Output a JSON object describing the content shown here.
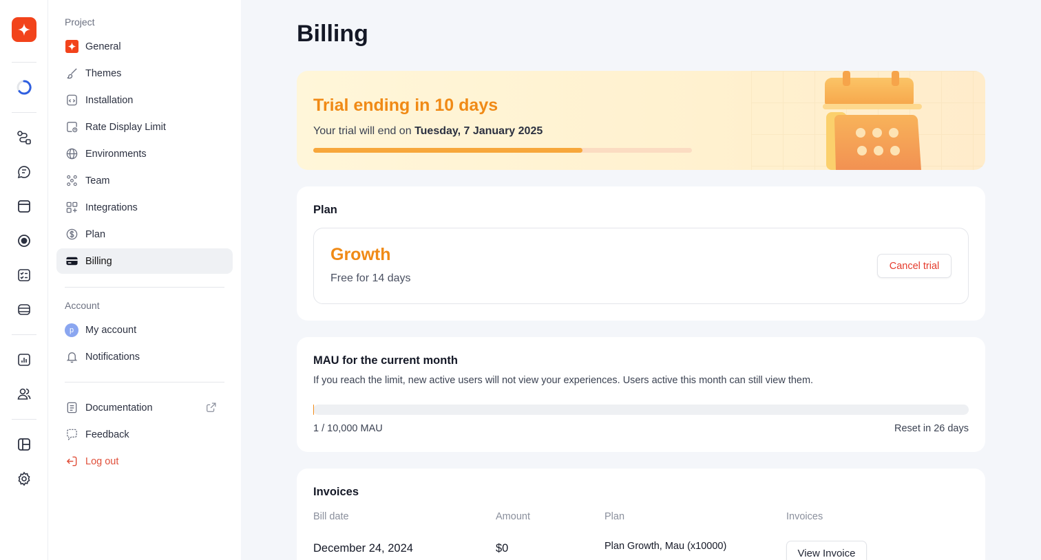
{
  "sidebar": {
    "project_label": "Project",
    "project_items": [
      {
        "label": "General",
        "icon": "brand-icon"
      },
      {
        "label": "Themes",
        "icon": "brush-icon"
      },
      {
        "label": "Installation",
        "icon": "code-file-icon"
      },
      {
        "label": "Rate Display Limit",
        "icon": "timer-icon"
      },
      {
        "label": "Environments",
        "icon": "globe-icon"
      },
      {
        "label": "Team",
        "icon": "team-icon"
      },
      {
        "label": "Integrations",
        "icon": "grid-plus-icon"
      },
      {
        "label": "Plan",
        "icon": "dollar-icon"
      },
      {
        "label": "Billing",
        "icon": "card-icon",
        "active": true
      }
    ],
    "account_label": "Account",
    "account_items": [
      {
        "label": "My account",
        "icon": "avatar-icon",
        "avatar_letter": "p"
      },
      {
        "label": "Notifications",
        "icon": "bell-icon"
      }
    ],
    "bottom_items": [
      {
        "label": "Documentation",
        "icon": "doc-icon"
      },
      {
        "label": "Feedback",
        "icon": "chat-icon"
      },
      {
        "label": "Log out",
        "icon": "logout-icon"
      }
    ]
  },
  "colors": {
    "brand": "#f2431b",
    "accent": "#f08a16",
    "danger": "#e53b2c"
  },
  "page": {
    "title": "Billing"
  },
  "trial": {
    "title": "Trial ending in 10 days",
    "text_prefix": "Your trial will end on",
    "end_date": "Tuesday, 7 January 2025",
    "progress": 0.71
  },
  "plan": {
    "heading": "Plan",
    "name": "Growth",
    "subtitle": "Free for 14 days",
    "cancel_label": "Cancel trial"
  },
  "mau": {
    "heading": "MAU for the current month",
    "description": "If you reach the limit, new active users will not view your experiences. Users active this month can still view them.",
    "count_label": "1 / 10,000 MAU",
    "reset_label": "Reset in 26 days",
    "used_fraction": 0.0001
  },
  "invoices": {
    "heading": "Invoices",
    "columns": [
      "Bill date",
      "Amount",
      "Plan",
      "Invoices"
    ],
    "rows": [
      {
        "date": "December 24, 2024",
        "amount": "$0",
        "plan": "Plan Growth, Mau (x10000)",
        "action": "View Invoice"
      }
    ]
  }
}
